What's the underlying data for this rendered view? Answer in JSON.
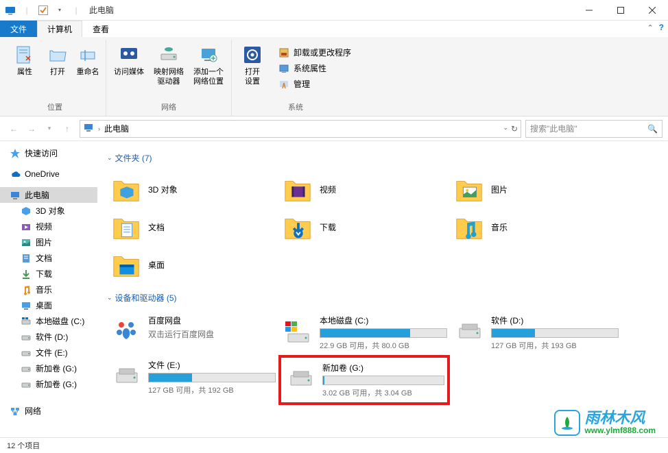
{
  "window": {
    "title": "此电脑"
  },
  "tabs": {
    "file": "文件",
    "computer": "计算机",
    "view": "查看"
  },
  "ribbon": {
    "location": {
      "properties": "属性",
      "open": "打开",
      "rename": "重命名",
      "group": "位置"
    },
    "network": {
      "access_media": "访问媒体",
      "map_drive": "映射网络\n驱动器",
      "add_location": "添加一个\n网络位置",
      "group": "网络"
    },
    "system": {
      "open_settings": "打开\n设置",
      "uninstall": "卸载或更改程序",
      "sys_props": "系统属性",
      "manage": "管理",
      "group": "系统"
    }
  },
  "address": {
    "crumb": "此电脑",
    "search_placeholder": "搜索\"此电脑\""
  },
  "sidebar": {
    "items": [
      {
        "label": "快速访问",
        "icon": "star"
      },
      {
        "label": "OneDrive",
        "icon": "onedrive"
      },
      {
        "label": "此电脑",
        "icon": "pc",
        "active": true
      },
      {
        "label": "3D 对象",
        "icon": "3d",
        "indent": true
      },
      {
        "label": "视频",
        "icon": "video",
        "indent": true
      },
      {
        "label": "图片",
        "icon": "pictures",
        "indent": true
      },
      {
        "label": "文档",
        "icon": "documents",
        "indent": true
      },
      {
        "label": "下载",
        "icon": "downloads",
        "indent": true
      },
      {
        "label": "音乐",
        "icon": "music",
        "indent": true
      },
      {
        "label": "桌面",
        "icon": "desktop",
        "indent": true
      },
      {
        "label": "本地磁盘 (C:)",
        "icon": "drive-c",
        "indent": true
      },
      {
        "label": "软件 (D:)",
        "icon": "drive",
        "indent": true
      },
      {
        "label": "文件 (E:)",
        "icon": "drive",
        "indent": true
      },
      {
        "label": "新加卷 (G:)",
        "icon": "drive",
        "indent": true
      },
      {
        "label": "新加卷 (G:)",
        "icon": "drive",
        "indent": true
      },
      {
        "label": "网络",
        "icon": "network"
      }
    ]
  },
  "content": {
    "folders_header": "文件夹 (7)",
    "folders": [
      {
        "label": "3D 对象",
        "icon": "3d"
      },
      {
        "label": "视频",
        "icon": "video"
      },
      {
        "label": "图片",
        "icon": "pictures"
      },
      {
        "label": "文档",
        "icon": "documents"
      },
      {
        "label": "下载",
        "icon": "downloads"
      },
      {
        "label": "音乐",
        "icon": "music"
      },
      {
        "label": "桌面",
        "icon": "desktop"
      }
    ],
    "drives_header": "设备和驱动器 (5)",
    "drives": [
      {
        "name": "百度网盘",
        "sub": "双击运行百度网盘",
        "icon": "baidu",
        "no_bar": true
      },
      {
        "name": "本地磁盘 (C:)",
        "status": "22.9 GB 可用，共 80.0 GB",
        "fill": 71,
        "icon": "drive-c"
      },
      {
        "name": "软件 (D:)",
        "status": "127 GB 可用，共 193 GB",
        "fill": 34,
        "icon": "drive"
      },
      {
        "name": "文件 (E:)",
        "status": "127 GB 可用，共 192 GB",
        "fill": 34,
        "icon": "drive"
      },
      {
        "name": "新加卷 (G:)",
        "status": "3.02 GB 可用，共 3.04 GB",
        "fill": 1,
        "icon": "drive",
        "highlight": true
      }
    ]
  },
  "status_bar": {
    "count": "12 个项目"
  },
  "watermark": {
    "title": "雨林木风",
    "url": "www.ylmf888.com"
  }
}
